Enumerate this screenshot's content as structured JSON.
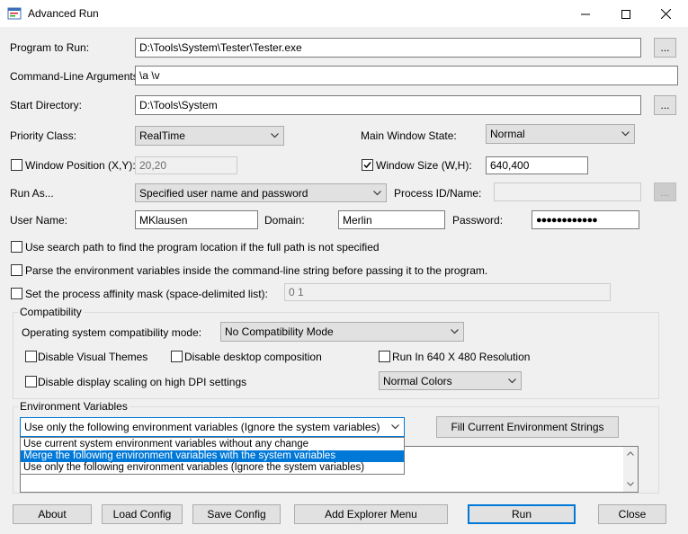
{
  "window": {
    "title": "Advanced Run",
    "icon": "app-window-icon",
    "controls": [
      "minimize-icon",
      "maximize-icon",
      "close-icon"
    ]
  },
  "program": {
    "label": "Program to Run:",
    "value": "D:\\Tools\\System\\Tester\\Tester.exe",
    "browse": "..."
  },
  "args": {
    "label": "Command-Line Arguments:",
    "value": "\\a \\v"
  },
  "startdir": {
    "label": "Start Directory:",
    "value": "D:\\Tools\\System",
    "browse": "..."
  },
  "priority": {
    "label": "Priority Class:",
    "value": "RealTime"
  },
  "main_state": {
    "label": "Main Window State:",
    "value": "Normal"
  },
  "winpos": {
    "label": "Window Position (X,Y):",
    "checked": false,
    "value": "20,20"
  },
  "winsize": {
    "label": "Window Size (W,H):",
    "checked": true,
    "value": "640,400"
  },
  "runas": {
    "label": "Run As...",
    "value": "Specified user name and password"
  },
  "pid": {
    "label": "Process ID/Name:",
    "value": "",
    "browse": "..."
  },
  "user": {
    "label": "User Name:",
    "value": "MKlausen"
  },
  "domain": {
    "label": "Domain:",
    "value": "Merlin"
  },
  "password": {
    "label": "Password:",
    "value": "●●●●●●●●●●●●"
  },
  "options": {
    "search_path": {
      "label": "Use search path to find the program location if the full path is not specified",
      "checked": false
    },
    "parse_env": {
      "label": "Parse the environment variables inside the command-line string before passing it to the program.",
      "checked": false
    },
    "affinity": {
      "label": "Set the process affinity mask (space-delimited list):",
      "checked": false,
      "value": "0 1"
    }
  },
  "compat": {
    "title": "Compatibility",
    "os_label": "Operating system compatibility mode:",
    "os_value": "No Compatibility Mode",
    "visual_themes": {
      "label": "Disable Visual Themes",
      "checked": false
    },
    "desktop_comp": {
      "label": "Disable desktop composition",
      "checked": false
    },
    "res640": {
      "label": "Run In 640 X 480 Resolution",
      "checked": false
    },
    "dpi_scaling": {
      "label": "Disable display scaling on high DPI settings",
      "checked": false
    },
    "colors_value": "Normal Colors"
  },
  "env": {
    "title": "Environment Variables",
    "mode_value": "Use only the following environment variables (Ignore the  system variables)",
    "fill_button": "Fill Current Environment Strings",
    "dropdown_options": [
      "Use current system environment variables without any change",
      "Merge the following environment variables with the system variables",
      "Use only the following environment variables (Ignore the  system variables)"
    ],
    "highlighted_option": 1
  },
  "buttons": {
    "about": "About",
    "load": "Load Config",
    "save": "Save Config",
    "explorer": "Add Explorer Menu",
    "run": "Run",
    "close": "Close"
  },
  "colors": {
    "accent": "#0078d7",
    "window_bg": "#f0f0f0",
    "button_bg": "#e1e1e1"
  }
}
